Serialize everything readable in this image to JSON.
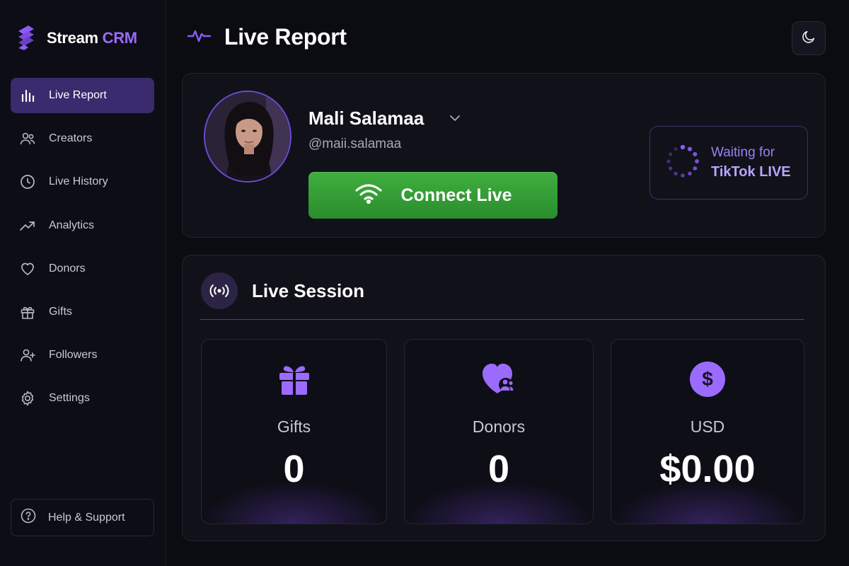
{
  "brand": {
    "name_part1": "Stream",
    "name_part2": "CRM",
    "logo_icon": "stream-s-logo"
  },
  "sidebar": {
    "items": [
      {
        "label": "Live Report",
        "icon": "bar-chart-icon",
        "active": true
      },
      {
        "label": "Creators",
        "icon": "users-icon",
        "active": false
      },
      {
        "label": "Live History",
        "icon": "clock-icon",
        "active": false
      },
      {
        "label": "Analytics",
        "icon": "trend-up-icon",
        "active": false
      },
      {
        "label": "Donors",
        "icon": "heart-icon",
        "active": false
      },
      {
        "label": "Gifts",
        "icon": "gift-icon",
        "active": false
      },
      {
        "label": "Followers",
        "icon": "user-plus-icon",
        "active": false
      },
      {
        "label": "Settings",
        "icon": "gear-icon",
        "active": false
      }
    ],
    "help_label": "Help & Support"
  },
  "header": {
    "title": "Live Report",
    "icon": "pulse-icon",
    "theme_toggle_icon": "moon-icon"
  },
  "profile": {
    "name": "Mali Salamaa",
    "handle": "@maii.salamaa",
    "connect_label": "Connect Live",
    "connect_icon": "wifi-icon",
    "waiting_line1": "Waiting for",
    "waiting_line2": "TikTok LIVE"
  },
  "session": {
    "title": "Live Session",
    "icon": "broadcast-icon",
    "stats": [
      {
        "label": "Gifts",
        "value": "0",
        "icon": "gift-icon"
      },
      {
        "label": "Donors",
        "value": "0",
        "icon": "heart-users-icon"
      },
      {
        "label": "USD",
        "value": "$0.00",
        "icon": "dollar-icon"
      }
    ]
  },
  "colors": {
    "accent": "#9b6bff",
    "active_nav": "#3a2a6e",
    "connect_green": "#2f9d33",
    "background": "#0b0b12"
  }
}
